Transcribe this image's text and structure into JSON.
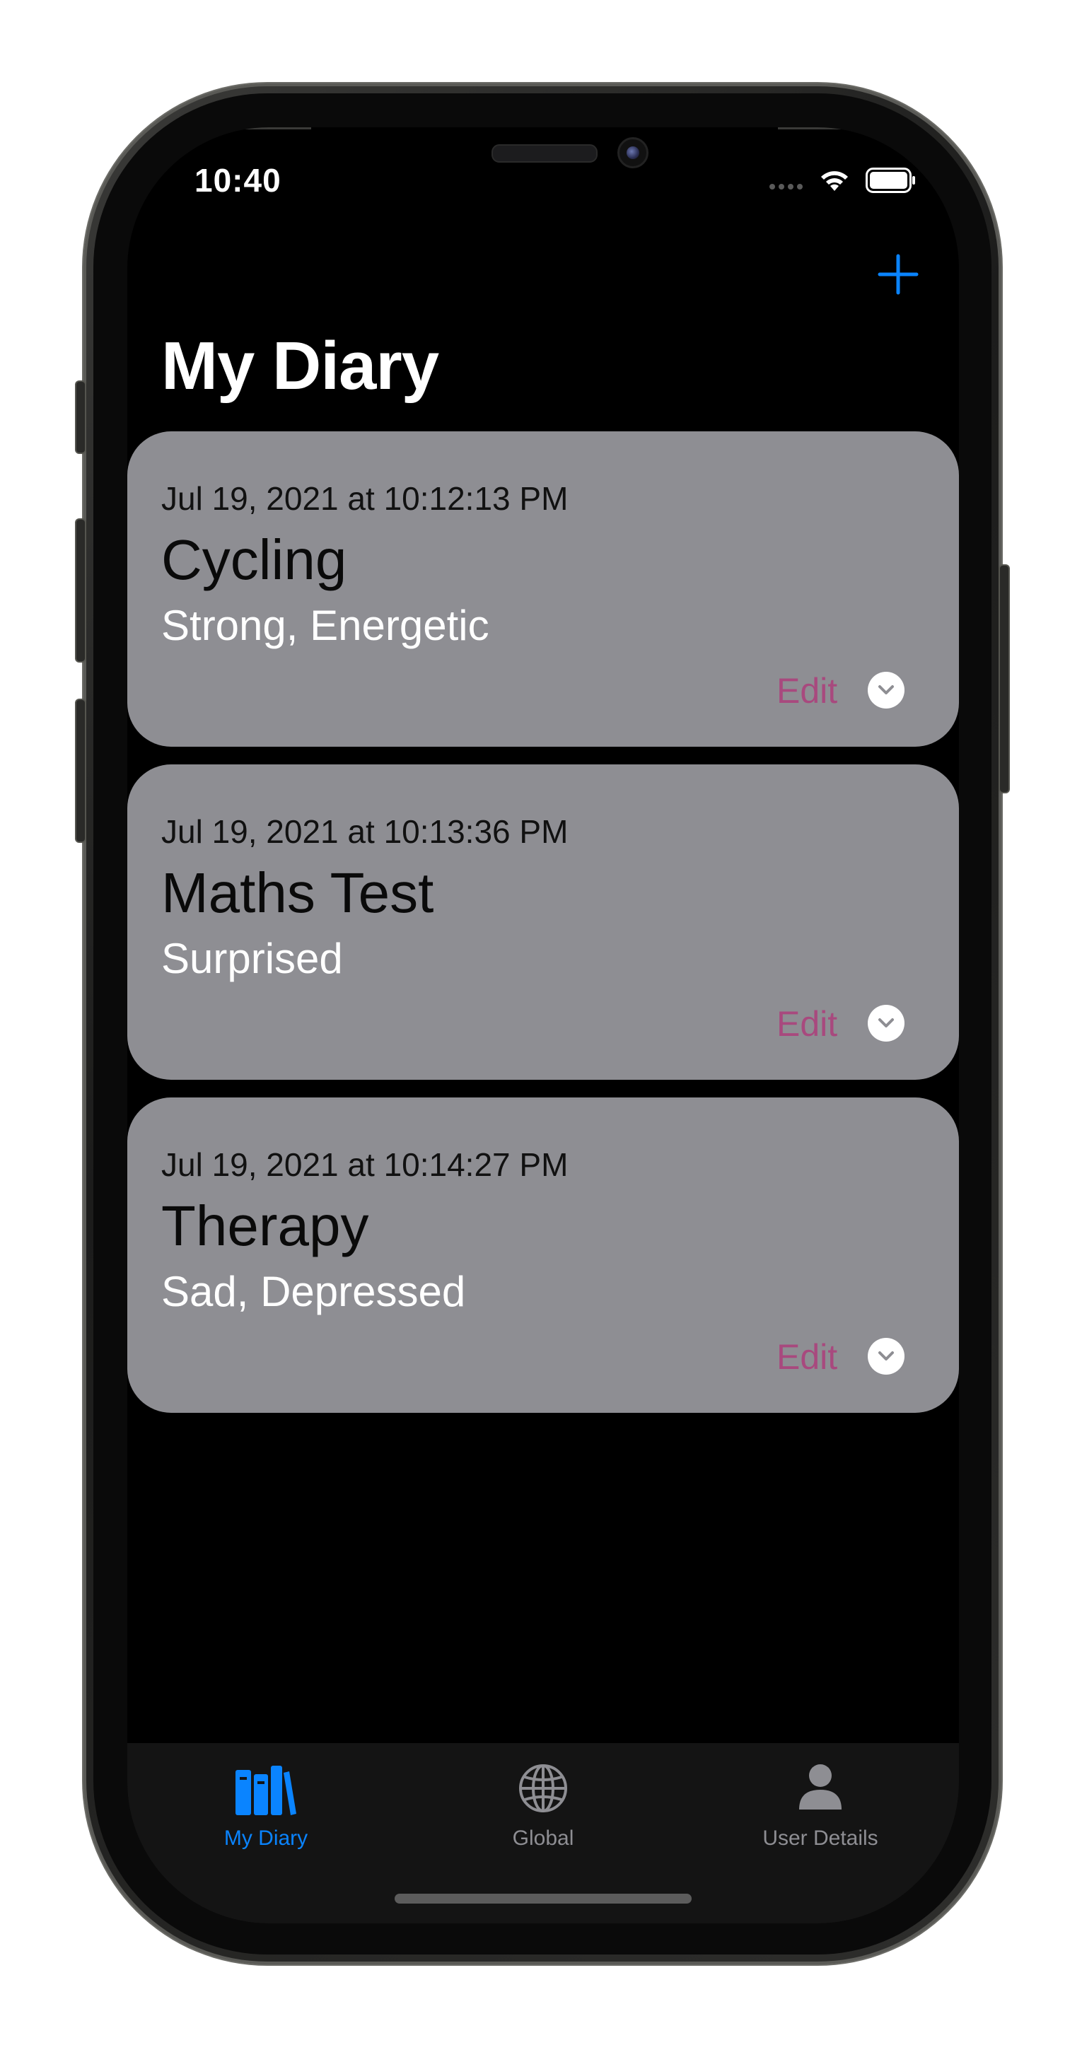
{
  "status_bar": {
    "time": "10:40"
  },
  "nav": {
    "title": "My Diary",
    "add_icon": "plus-icon",
    "accent_color": "#0a84ff"
  },
  "entries": [
    {
      "date": "Jul 19, 2021 at 10:12:13 PM",
      "title": "Cycling",
      "moods": "Strong, Energetic",
      "edit_label": "Edit",
      "expand_icon": "chevron-down-icon"
    },
    {
      "date": "Jul 19, 2021 at 10:13:36 PM",
      "title": "Maths Test",
      "moods": "Surprised",
      "edit_label": "Edit",
      "expand_icon": "chevron-down-icon"
    },
    {
      "date": "Jul 19, 2021 at 10:14:27 PM",
      "title": "Therapy",
      "moods": "Sad, Depressed",
      "edit_label": "Edit",
      "expand_icon": "chevron-down-icon"
    }
  ],
  "tab_bar": {
    "tabs": [
      {
        "label": "My Diary",
        "icon": "books-icon",
        "active": true
      },
      {
        "label": "Global",
        "icon": "globe-icon",
        "active": false
      },
      {
        "label": "User Details",
        "icon": "person-icon",
        "active": false
      }
    ],
    "active_color": "#0a84ff",
    "inactive_color": "#8e8e93"
  },
  "colors": {
    "card_background": "#8e8e93",
    "edit_text": "#a8497e",
    "background": "#000000"
  }
}
